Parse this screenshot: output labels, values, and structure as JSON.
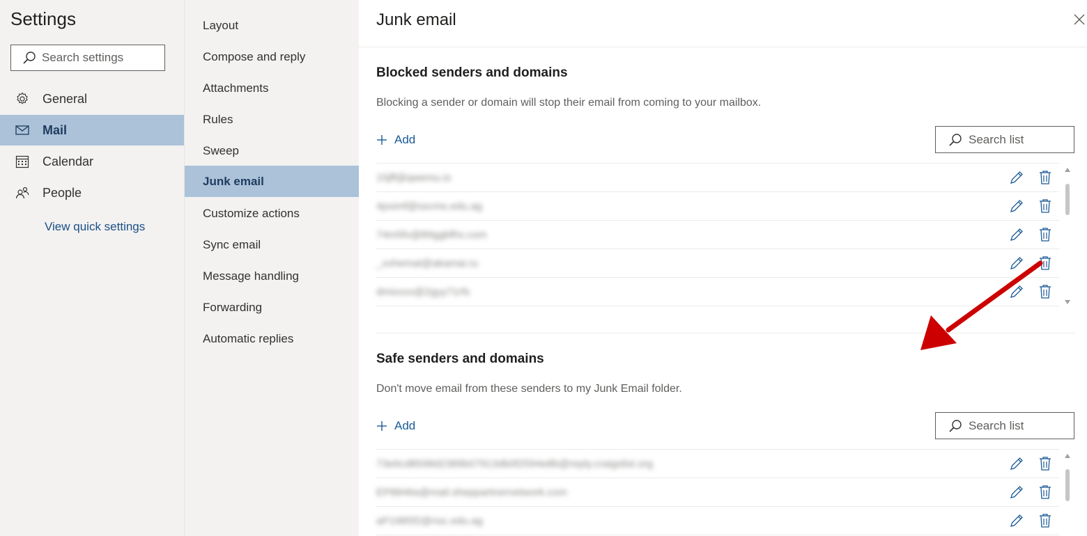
{
  "settings": {
    "title": "Settings",
    "search_placeholder": "Search settings",
    "nav": [
      {
        "label": "General",
        "icon": "gear-icon"
      },
      {
        "label": "Mail",
        "icon": "mail-icon"
      },
      {
        "label": "Calendar",
        "icon": "calendar-icon"
      },
      {
        "label": "People",
        "icon": "people-icon"
      }
    ],
    "quick_link": "View quick settings"
  },
  "mail_nav": {
    "items": [
      "Layout",
      "Compose and reply",
      "Attachments",
      "Rules",
      "Sweep",
      "Junk email",
      "Customize actions",
      "Sync email",
      "Message handling",
      "Forwarding",
      "Automatic replies"
    ],
    "active": "Junk email"
  },
  "panel": {
    "title": "Junk email",
    "blocked": {
      "title": "Blocked senders and domains",
      "description": "Blocking a sender or domain will stop their email from coming to your mailbox.",
      "add_label": "Add",
      "search_placeholder": "Search list",
      "entries": [
        "15jff@qwemu.io",
        "4pximf@sscms.edu.ag",
        "74m5fx@89ggbfhs.com",
        "_xxhemat@akamai.ru",
        "dmixxxx@2gyy71rfs"
      ]
    },
    "safe": {
      "title": "Safe senders and domains",
      "description": "Don't move email from these senders to my Junk Email folder.",
      "add_label": "Add",
      "search_placeholder": "Search list",
      "entries": [
        "73e6cd8598d2389b07913db0f2594e8b@reply.craigslist.org",
        "EP8846a@mail.sheppartnernetwork.com",
        "aP1985f2@nsc.edu.ag"
      ]
    }
  },
  "colors": {
    "active_bg": "#abc2d9",
    "link": "#1a5a96",
    "annotation_arrow": "#cc0000"
  }
}
